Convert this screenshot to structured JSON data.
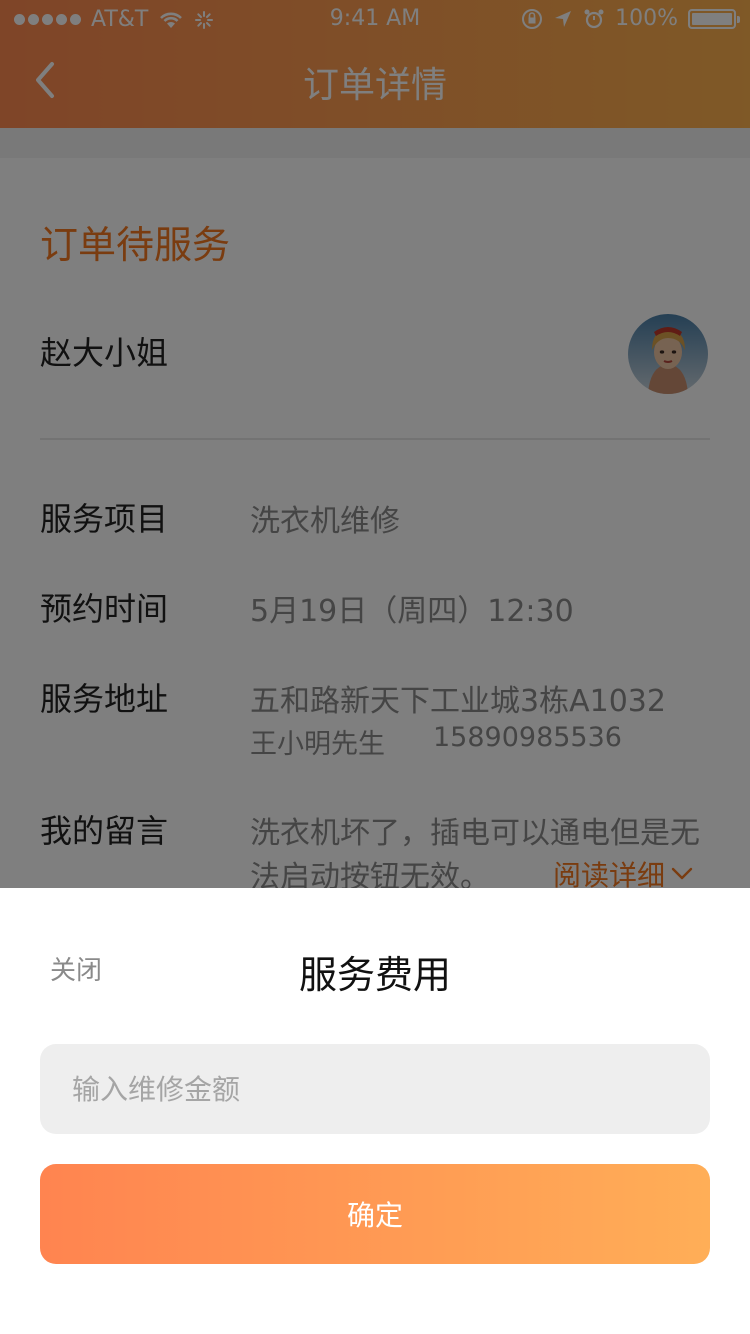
{
  "status_bar": {
    "carrier": "AT&T",
    "time": "9:41 AM",
    "battery": "100%"
  },
  "navbar": {
    "title": "订单详情"
  },
  "order": {
    "status": "订单待服务",
    "customer_name": "赵大小姐",
    "rows": [
      {
        "label": "服务项目",
        "value": "洗衣机维修"
      },
      {
        "label": "预约时间",
        "value": "5月19日（周四）12:30"
      },
      {
        "label": "服务地址",
        "value": "五和路新天下工业城3栋A1032",
        "contact_name": "王小明先生",
        "contact_phone": "15890985536"
      },
      {
        "label": "我的留言",
        "value_line1": "洗衣机坏了，插电可以通电但是无",
        "value_line2": "法启动按钮无效。"
      }
    ],
    "read_more": "阅读详细"
  },
  "sheet": {
    "close_label": "关闭",
    "title": "服务费用",
    "input_placeholder": "输入维修金额",
    "confirm_label": "确定"
  },
  "colors": {
    "accent": "#f47920",
    "header_gradient_start": "#ff8a50",
    "header_gradient_end": "#ffb24f",
    "button_gradient_start": "#ff8450",
    "button_gradient_end": "#ffae57"
  }
}
